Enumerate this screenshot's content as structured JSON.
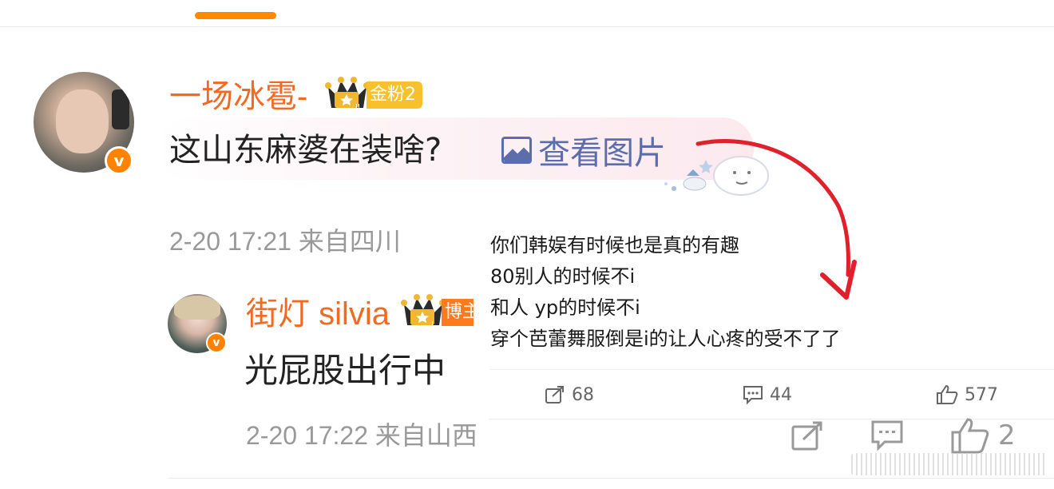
{
  "colors": {
    "accent": "#ff8a00",
    "username": "#f26a21",
    "link": "#5b6eab",
    "meta": "#999999",
    "arrow": "#e0202a"
  },
  "comment": {
    "username": "一场冰雹-",
    "fan_badge": "金粉2",
    "crown_level": "II",
    "text": "这山东麻婆在装啥?",
    "view_image_label": "查看图片",
    "meta": "2-20 17:21 来自四川"
  },
  "reply": {
    "username": "街灯 silvia",
    "host_badge": "博主",
    "crown_level": "I",
    "text": "光屁股出行中",
    "meta": "2-20 17:22 来自山西",
    "actions": {
      "like_count": "2"
    }
  },
  "overlay_post": {
    "lines": [
      "你们韩娱有时候也是真的有趣",
      "80别人的时候不i",
      "和人 yp的时候不i",
      "穿个芭蕾舞服倒是i的让人心疼的受不了了"
    ],
    "repost_count": "68",
    "comment_count": "44",
    "like_count": "577"
  },
  "icons": {
    "verified": "v-badge-icon",
    "image": "image-icon",
    "repost": "repost-icon",
    "comment": "comment-icon",
    "like": "thumbs-up-icon"
  }
}
